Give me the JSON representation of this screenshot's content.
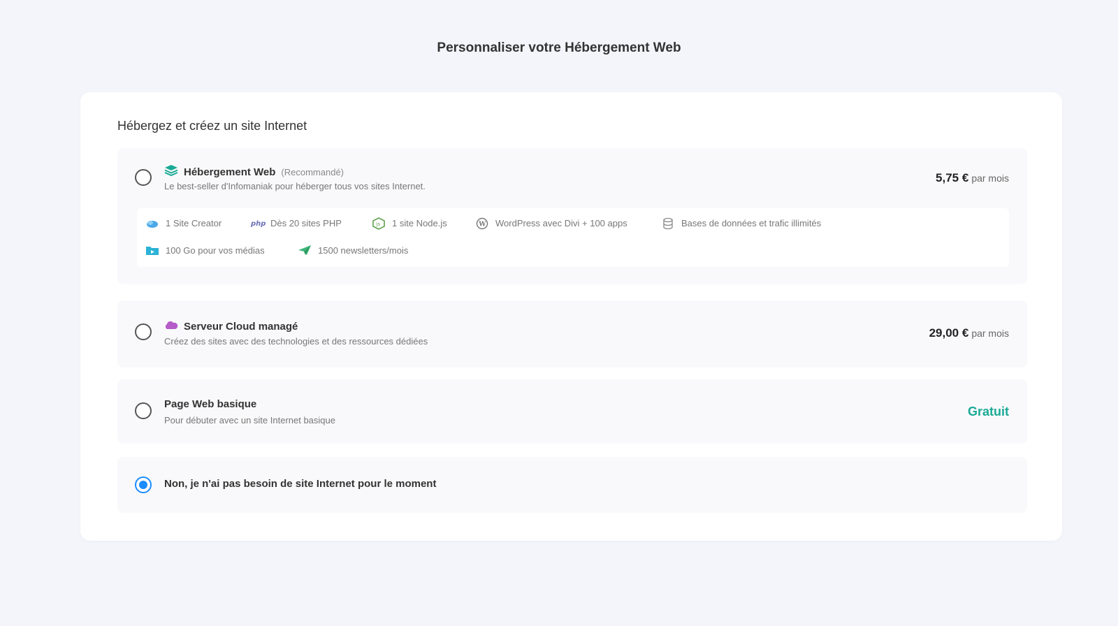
{
  "page": {
    "title": "Personnaliser votre Hébergement Web"
  },
  "section": {
    "title": "Hébergez et créez un site Internet"
  },
  "options": [
    {
      "title": "Hébergement Web",
      "tag": "(Recommandé)",
      "description": "Le best-seller d'Infomaniak pour héberger tous vos sites Internet.",
      "price": "5,75 €",
      "price_unit": "par mois",
      "icon": "stack-icon",
      "selected": false,
      "features": [
        {
          "label": "1 Site Creator",
          "icon": "site-creator-icon"
        },
        {
          "label": "Dès 20 sites PHP",
          "icon": "php-icon"
        },
        {
          "label": "1 site Node.js",
          "icon": "nodejs-icon"
        },
        {
          "label": "WordPress avec Divi + 100 apps",
          "icon": "wordpress-icon"
        },
        {
          "label": "Bases de données et trafic illimités",
          "icon": "database-icon"
        },
        {
          "label": "100 Go pour vos médias",
          "icon": "media-folder-icon"
        },
        {
          "label": "1500 newsletters/mois",
          "icon": "paper-plane-icon"
        }
      ]
    },
    {
      "title": "Serveur Cloud managé",
      "description": "Créez des sites avec des technologies et des ressources dédiées",
      "price": "29,00 €",
      "price_unit": "par mois",
      "icon": "cloud-icon",
      "selected": false
    },
    {
      "title": "Page Web basique",
      "description": "Pour débuter avec un site Internet basique",
      "price": "Gratuit",
      "selected": false
    },
    {
      "title": "Non, je n'ai pas besoin de site Internet pour le moment",
      "selected": true
    }
  ],
  "colors": {
    "background": "#f3f5fb",
    "accent_radio": "#1a8cff",
    "free_price": "#1aaa96",
    "stack_icon": "#1aaa96",
    "cloud_icon": "#b45cc8"
  }
}
